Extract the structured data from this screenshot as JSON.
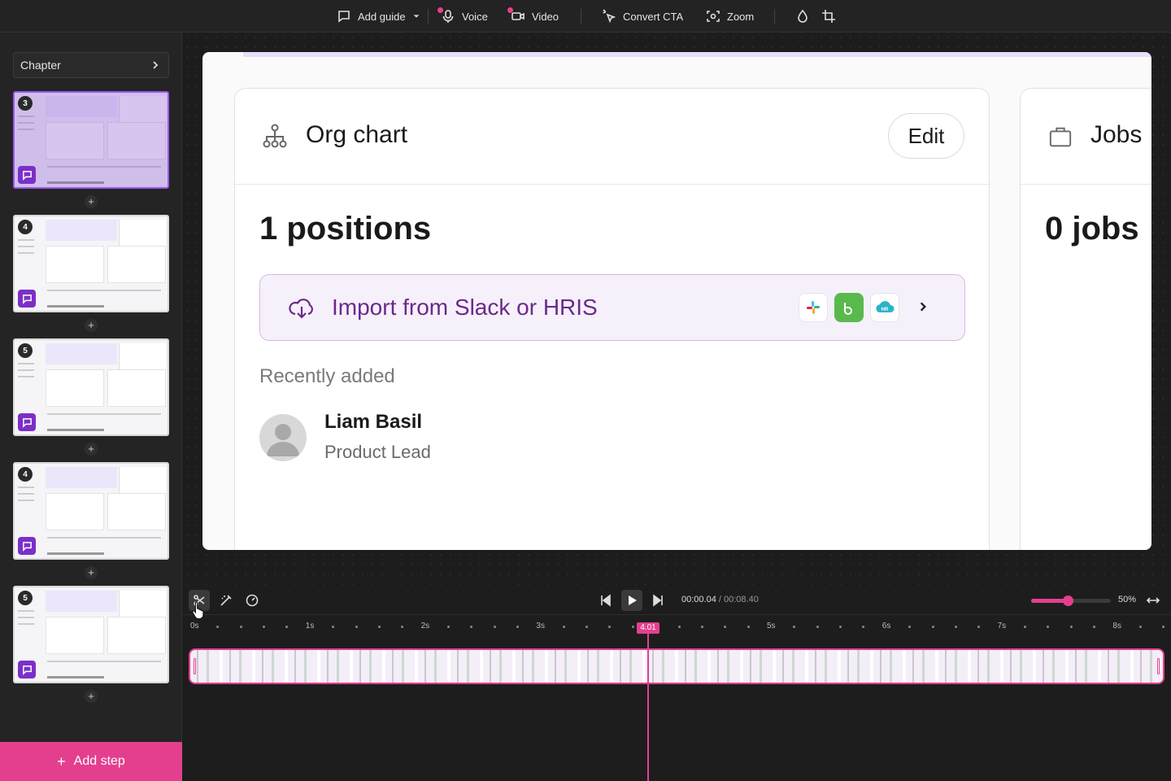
{
  "toolbar": {
    "add_guide": "Add guide",
    "voice": "Voice",
    "video": "Video",
    "convert_cta": "Convert CTA",
    "zoom": "Zoom"
  },
  "sidebar": {
    "chapter_label": "Chapter",
    "steps": [
      {
        "number": "3",
        "active": true
      },
      {
        "number": "4",
        "active": false
      },
      {
        "number": "5",
        "active": false
      },
      {
        "number": "4",
        "active": false
      },
      {
        "number": "5",
        "active": false
      }
    ],
    "add_step_label": "Add step"
  },
  "preview": {
    "org_card": {
      "title": "Org chart",
      "edit_label": "Edit",
      "count": "1 positions",
      "import_label": "Import from Slack or HRIS",
      "recent_label": "Recently added",
      "person_name": "Liam Basil",
      "person_role": "Product Lead"
    },
    "jobs_card": {
      "title": "Jobs",
      "count": "0 jobs"
    }
  },
  "timeline": {
    "current_time": "00:00.04",
    "total_time": "00:08.40",
    "zoom_percent": "50%",
    "zoom_level": 0.46,
    "playhead_label": "4.01",
    "ticks": [
      "0s",
      "1s",
      "2s",
      "3s",
      "5s",
      "6s",
      "7s",
      "8s"
    ]
  },
  "colors": {
    "accent": "#e43f8f",
    "step_chat": "#7b2fc9",
    "import_text": "#6a2a8a"
  }
}
